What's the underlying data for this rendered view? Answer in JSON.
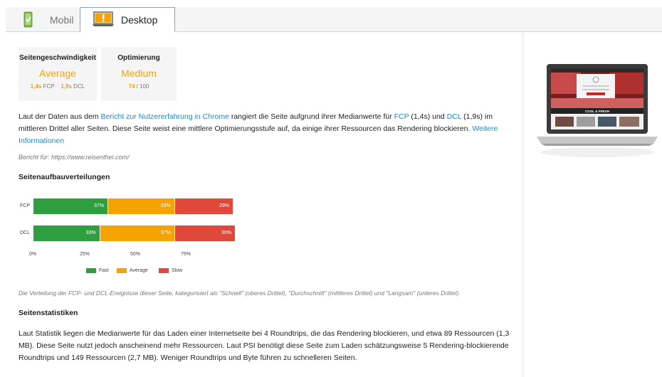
{
  "tabs": [
    {
      "label": "Mobil",
      "icon": "mobile-check-icon",
      "active": false
    },
    {
      "label": "Desktop",
      "icon": "desktop-warning-icon",
      "active": true
    }
  ],
  "cards": {
    "speed": {
      "title": "Seitengeschwindigkeit",
      "value": "Average",
      "fcp_value": "1,4s",
      "fcp_label": "FCP",
      "dcl_value": "1,9s",
      "dcl_label": "DCL"
    },
    "optimization": {
      "title": "Optimierung",
      "value": "Medium",
      "score": "74",
      "score_suffix": "/ 100"
    }
  },
  "summary": {
    "t1": "Laut der Daten aus dem ",
    "link1": "Bericht zur Nutzererfahrung in Chrome",
    "t2": " rangiert die Seite aufgrund ihrer Medianwerte für ",
    "link2": "FCP",
    "t3": " (1,4s) und ",
    "link3": "DCL",
    "t4": " (1,9s) im mittleren Drittel aller Seiten. Diese Seite weist eine mittlere Optimierungsstufe auf, da einige ihrer Ressourcen das Rendering blockieren. ",
    "link4": "Weitere Informationen"
  },
  "report_for": "Bericht für: https://www.reisenthel.com/",
  "distribution_heading": "Seitenaufbauverteilungen",
  "chart_data": {
    "type": "bar",
    "orientation": "horizontal",
    "stacked": true,
    "categories": [
      "FCP",
      "DCL"
    ],
    "series": [
      {
        "name": "Fast",
        "color": "#2e9e3e",
        "values": [
          37,
          33
        ],
        "labels": [
          "37%",
          "33%"
        ]
      },
      {
        "name": "Average",
        "color": "#f4a300",
        "values": [
          33,
          37
        ],
        "labels": [
          "33%",
          "37%"
        ]
      },
      {
        "name": "Slow",
        "color": "#e0483a",
        "values": [
          29,
          30
        ],
        "labels": [
          "29%",
          "30%"
        ]
      }
    ],
    "xticks": [
      "0%",
      "25%",
      "50%",
      "75%"
    ],
    "xlim": [
      0,
      100
    ],
    "legend": "bottom"
  },
  "caption": "Die Verteilung der FCP- und DCL-Ereignisse dieser Seite, kategorisiert als \"Schnell\" (oberes Drittel), \"Durchschnitt\" (mittleres Drittel) und \"Langsam\" (unteres Drittel).",
  "stats_heading": "Seitenstatistiken",
  "stats_text": "Laut Statistik liegen die Medianwerte für das Laden einer Internetseite bei 4 Roundtrips, die das Rendering blockieren, und etwa 89 Ressourcen (1,3 MB). Diese Seite nutzt jedoch anscheinend mehr Ressourcen. Laut PSI benötigt diese Seite zum Laden schätzungsweise 5 Rendering-blockierende Roundtrips und 149 Ressourcen (2,7 MB). Weniger Roundtrips und Byte führen zu schnelleren Seiten.",
  "preview": {
    "screen_banner": "COOL & FRESH"
  }
}
